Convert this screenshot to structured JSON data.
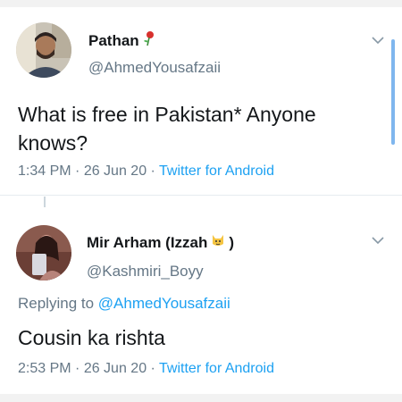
{
  "tweets": [
    {
      "display_name": "Pathan",
      "name_emoji": "rose-icon",
      "handle": "@AhmedYousafzaii",
      "text": "What is free in Pakistan* Anyone knows?",
      "time": "1:34 PM",
      "date": "26 Jun 20",
      "source": "Twitter for Android"
    },
    {
      "display_name": "Mir Arham (Izzah",
      "name_emoji": "cat-face-icon",
      "name_suffix": ")",
      "handle": "@Kashmiri_Boyy",
      "replying_prefix": "Replying to",
      "replying_to": "@AhmedYousafzaii",
      "text": "Cousin ka rishta",
      "time": "2:53 PM",
      "date": "26 Jun 20",
      "source": "Twitter for Android"
    }
  ],
  "separator": " · ",
  "colors": {
    "link": "#1da1f2",
    "secondary": "#657786",
    "primary_text": "#14171a"
  }
}
